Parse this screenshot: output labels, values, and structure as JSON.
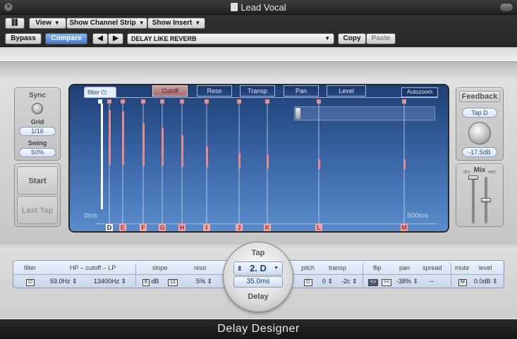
{
  "window": {
    "title": "Lead Vocal"
  },
  "toolbar": {
    "view": "View",
    "show_channel_strip": "Show Channel Strip",
    "show_insert": "Show Insert",
    "bypass": "Bypass",
    "compare": "Compare",
    "preset": "DELAY LIKE REVERB",
    "copy": "Copy",
    "paste": "Paste"
  },
  "sync": {
    "title": "Sync",
    "grid_label": "Grid",
    "grid_value": "1/16",
    "swing_label": "Swing",
    "swing_value": "50%"
  },
  "tap_controls": {
    "start": "Start",
    "last_tap": "Last Tap"
  },
  "display": {
    "filter_tab": "filter",
    "view_buttons": [
      "Cutoff",
      "Reso",
      "Transp",
      "Pan",
      "Level"
    ],
    "active_view": "Cutoff",
    "autozoom": "Autozoom",
    "time_start": "0ms",
    "time_end": "500ms"
  },
  "taps": [
    {
      "id": "D",
      "cutoff_level": 0.92
    },
    {
      "id": "E",
      "cutoff_level": 0.9
    },
    {
      "id": "F",
      "cutoff_level": 0.7
    },
    {
      "id": "G",
      "cutoff_level": 0.62
    },
    {
      "id": "H",
      "cutoff_level": 0.5
    },
    {
      "id": "I",
      "cutoff_level": 0.32
    },
    {
      "id": "J",
      "cutoff_level": 0.2
    },
    {
      "id": "K",
      "cutoff_level": 0.17
    },
    {
      "id": "L",
      "cutoff_level": 0.1
    },
    {
      "id": "M",
      "cutoff_level": 0.1
    }
  ],
  "feedback": {
    "title": "Feedback",
    "tap": "Tap D",
    "value": "-17.5dB"
  },
  "mix": {
    "title": "Mix",
    "dry": "dry",
    "wet": "wet"
  },
  "tap_params": {
    "filter_label": "filter",
    "filter_range_label": "HP – cutoff – LP",
    "hp": "59.0Hz",
    "lp": "13400Hz",
    "slope_label": "slope",
    "slope_a": "6",
    "slope_unit": "dB",
    "slope_b": "12",
    "reso_label": "reso",
    "reso": "5%",
    "pitch_label": "pitch",
    "transp_label": "transp",
    "pitch_value": "0",
    "transp": "-2c",
    "flip_label": "flip",
    "pan_label": "pan",
    "spread_label": "spread",
    "pan": "-38%",
    "spread": "--",
    "mute_label": "mute",
    "level_label": "level",
    "mute": "M",
    "level": "0.0dB"
  },
  "tap_selector": {
    "title": "Tap",
    "selected": "2. D",
    "delay_value": "35.0ms",
    "delay_label": "Delay"
  },
  "plugin": {
    "name": "Delay Designer"
  }
}
